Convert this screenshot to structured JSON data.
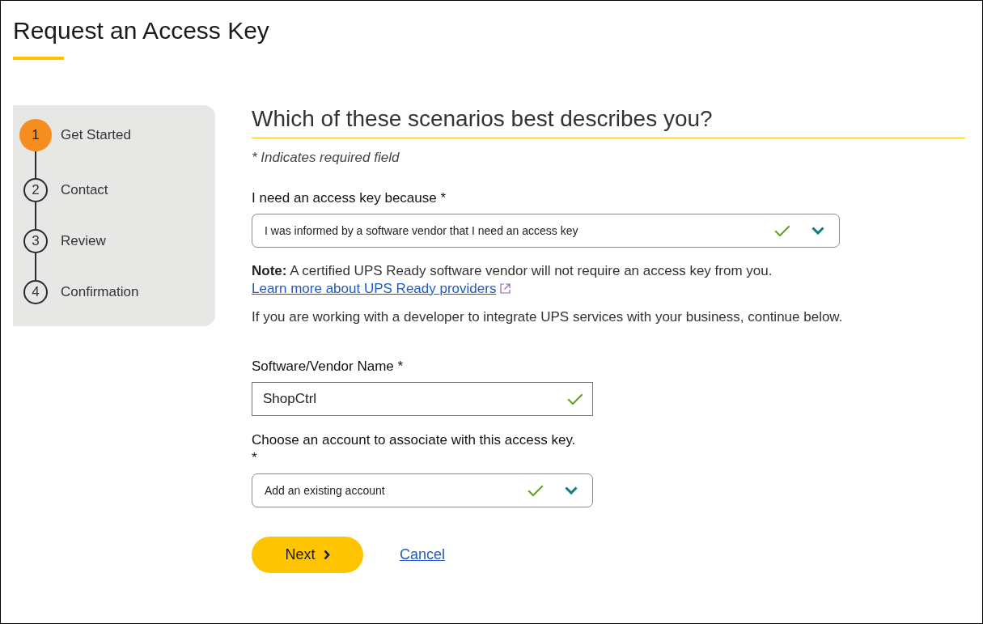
{
  "page_title": "Request an Access Key",
  "steps": [
    {
      "number": "1",
      "label": "Get Started",
      "selected": true
    },
    {
      "number": "2",
      "label": "Contact",
      "selected": false
    },
    {
      "number": "3",
      "label": "Review",
      "selected": false
    },
    {
      "number": "4",
      "label": "Confirmation",
      "selected": false
    }
  ],
  "form": {
    "heading": "Which of these scenarios best describes you?",
    "required_note": "* Indicates required field",
    "reason_select": {
      "label": "I need an access key because *",
      "value": "I was informed by a software vendor that I need an access key",
      "valid": true
    },
    "note": {
      "text": "**Note:** A certified UPS Ready software vendor will not require an access key from you.",
      "link": "Learn more about UPS Ready providers"
    },
    "info_text": "If you are working with a developer to integrate UPS services with your business, continue below.",
    "vendor_name_field": {
      "label": "Software/Vendor Name *",
      "value": "ShopCtrl",
      "valid": true
    },
    "account_select": {
      "label": "Choose an account to associate with this access key. *",
      "value": "Add an existing account",
      "valid": true
    },
    "actions": {
      "next": "Next",
      "cancel": "Cancel"
    }
  }
}
